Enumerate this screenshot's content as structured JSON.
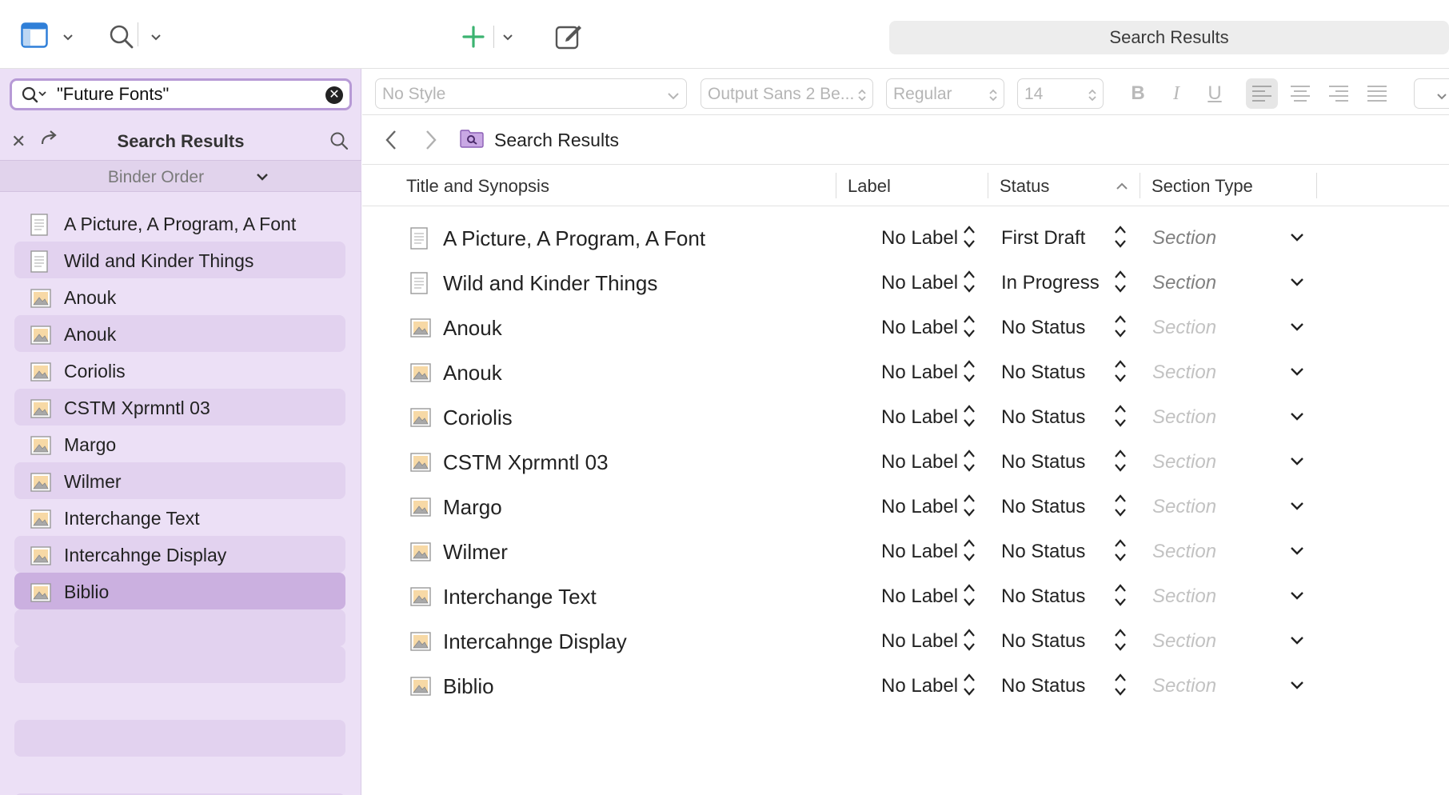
{
  "toolbar": {
    "search_results_label": "Search Results"
  },
  "sidebar": {
    "search_value": "\"Future Fonts\"",
    "title": "Search Results",
    "sort_label": "Binder Order",
    "items": [
      {
        "label": "A Picture, A Program, A Font",
        "icon": "text-document-icon"
      },
      {
        "label": "Wild and Kinder Things",
        "icon": "text-document-icon"
      },
      {
        "label": "Anouk",
        "icon": "image-document-icon"
      },
      {
        "label": "Anouk",
        "icon": "image-document-icon"
      },
      {
        "label": "Coriolis",
        "icon": "image-document-icon"
      },
      {
        "label": "CSTM Xprmntl 03",
        "icon": "image-document-icon"
      },
      {
        "label": "Margo",
        "icon": "image-document-icon"
      },
      {
        "label": "Wilmer",
        "icon": "image-document-icon"
      },
      {
        "label": "Interchange Text",
        "icon": "image-document-icon"
      },
      {
        "label": "Intercahnge Display",
        "icon": "image-document-icon"
      },
      {
        "label": "Biblio",
        "icon": "image-document-icon"
      }
    ]
  },
  "formatbar": {
    "style": "No Style",
    "font": "Output Sans 2 Be...",
    "weight": "Regular",
    "size": "14",
    "bold": "B",
    "italic": "I",
    "underline": "U"
  },
  "navbar": {
    "title": "Search Results"
  },
  "outline": {
    "headers": {
      "title": "Title and Synopsis",
      "label": "Label",
      "status": "Status",
      "section_type": "Section Type"
    },
    "rows": [
      {
        "title": "A Picture, A Program, A Font",
        "icon": "text-document-icon",
        "label": "No Label",
        "status": "First Draft",
        "section_type": "Section"
      },
      {
        "title": "Wild and Kinder Things",
        "icon": "text-document-icon",
        "label": "No Label",
        "status": "In Progress",
        "section_type": "Section"
      },
      {
        "title": "Anouk",
        "icon": "image-document-icon",
        "label": "No Label",
        "status": "No Status",
        "section_type": "Section"
      },
      {
        "title": "Anouk",
        "icon": "image-document-icon",
        "label": "No Label",
        "status": "No Status",
        "section_type": "Section"
      },
      {
        "title": "Coriolis",
        "icon": "image-document-icon",
        "label": "No Label",
        "status": "No Status",
        "section_type": "Section"
      },
      {
        "title": "CSTM Xprmntl 03",
        "icon": "image-document-icon",
        "label": "No Label",
        "status": "No Status",
        "section_type": "Section"
      },
      {
        "title": "Margo",
        "icon": "image-document-icon",
        "label": "No Label",
        "status": "No Status",
        "section_type": "Section"
      },
      {
        "title": "Wilmer",
        "icon": "image-document-icon",
        "label": "No Label",
        "status": "No Status",
        "section_type": "Section"
      },
      {
        "title": "Interchange Text",
        "icon": "image-document-icon",
        "label": "No Label",
        "status": "No Status",
        "section_type": "Section"
      },
      {
        "title": "Intercahnge Display",
        "icon": "image-document-icon",
        "label": "No Label",
        "status": "No Status",
        "section_type": "Section"
      },
      {
        "title": "Biblio",
        "icon": "image-document-icon",
        "label": "No Label",
        "status": "No Status",
        "section_type": "Section"
      }
    ]
  },
  "colors": {
    "sidebar_bg": "#ece0f6",
    "sidebar_selected": "#cbb0e0",
    "add_green": "#3cb371",
    "accent_purple": "#b79ad6"
  }
}
